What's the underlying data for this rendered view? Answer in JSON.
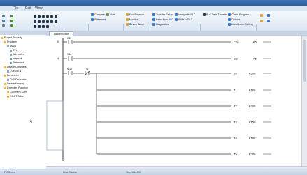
{
  "menu": [
    "File",
    "Edit",
    "View"
  ],
  "project_pane": {
    "title": "Project Property",
    "items": [
      {
        "label": "Program",
        "depth": 1,
        "icon": "folder"
      },
      {
        "label": "MAIN",
        "depth": 2,
        "icon": "doc"
      },
      {
        "label": "STL",
        "depth": 3,
        "icon": "doc"
      },
      {
        "label": "Subroutine",
        "depth": 3,
        "icon": "doc"
      },
      {
        "label": "Interrupt",
        "depth": 3,
        "icon": "doc"
      },
      {
        "label": "Statement",
        "depth": 3,
        "icon": "doc"
      },
      {
        "label": "Device Comment",
        "depth": 1,
        "icon": "folder"
      },
      {
        "label": "COMMENT",
        "depth": 2,
        "icon": "doc"
      },
      {
        "label": "Parameter",
        "depth": 1,
        "icon": "folder"
      },
      {
        "label": "PLC Parameter",
        "depth": 2,
        "icon": "doc"
      },
      {
        "label": "Device Memory",
        "depth": 1,
        "icon": "folder"
      },
      {
        "label": "Extended Function",
        "depth": 1,
        "icon": "folder"
      },
      {
        "label": "Comment Conv",
        "depth": 2,
        "icon": "doc"
      },
      {
        "label": "ROOT Table",
        "depth": 2,
        "icon": "doc"
      }
    ]
  },
  "editor": {
    "tab": "Ladder Mode",
    "rungs": [
      {
        "step": "0",
        "contact": "X11",
        "coil": "C10",
        "operand": "K5"
      },
      {
        "step": "4",
        "contact": "X10",
        "coil": "C11",
        "operand": "K5"
      },
      {
        "step": "",
        "contact": "M10",
        "contact2": "T1",
        "coil": "T0",
        "operand": "K200"
      },
      {
        "coil": "T1",
        "operand": "K100"
      },
      {
        "coil": "T2",
        "operand": "K200"
      },
      {
        "coil": "T3",
        "operand": "K150"
      },
      {
        "coil": "T4",
        "operand": "K100"
      },
      {
        "coil": "T5",
        "operand": "K300"
      }
    ]
  },
  "ribbon": {
    "groups": [
      "Project",
      "Edit",
      "Ladder Symbol",
      "Label",
      "Program Editor",
      "Online",
      "Ladder Diagram",
      "Tool"
    ],
    "buttons": [
      "Compare",
      "Statement",
      "Note",
      "Find/Replace",
      "Transfer Setup",
      "Verify with PLC",
      "Read from PLC",
      "Write to PLC",
      "Diagnostics",
      "Monitor",
      "Device Batch",
      "PLC Data Transfer",
      "Check Program",
      "Options",
      "Local Label Setting"
    ]
  },
  "status_bar": [
    "FX Series",
    "Host Station",
    "Step 0/16000"
  ],
  "colors": {
    "rail": "#3b3b3b",
    "accent": "#2f5f9d"
  }
}
